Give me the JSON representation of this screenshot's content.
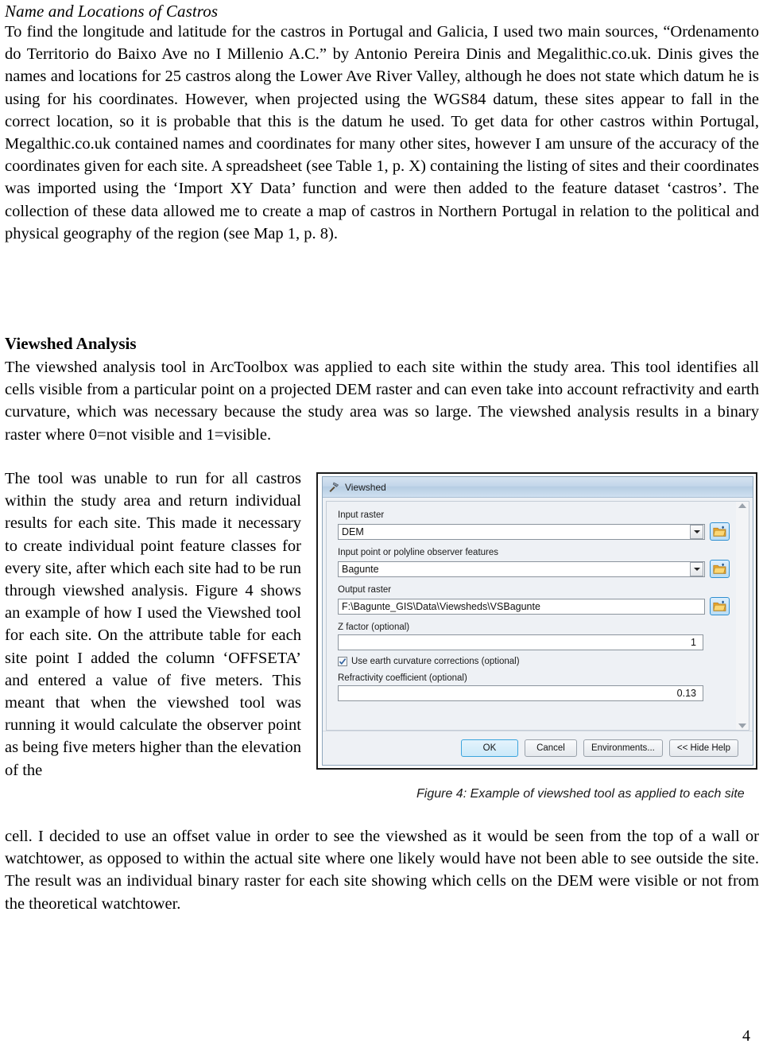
{
  "document": {
    "page_number": "4",
    "sections": [
      {
        "heading": "Name and Locations of Castros",
        "heading_style": "italic",
        "paragraph": "To find the longitude and latitude for the castros in Portugal and Galicia, I used two main sources, “Ordenamento do Territorio do Baixo Ave no I Millenio A.C.” by Antonio Pereira Dinis and Megalithic.co.uk. Dinis gives the names and locations for 25 castros along the Lower Ave River Valley, although he does not state which datum he is using for his coordinates. However, when projected using the WGS84 datum, these sites appear to fall in the correct location, so it is probable that this is the datum he used. To get data for other castros within Portugal, Megalthic.co.uk contained names and coordinates for many other sites, however I am unsure of the accuracy of the coordinates given for each site. A spreadsheet (see Table 1, p. X) containing the listing of sites and their coordinates was imported using the ‘Import XY Data’ function and were then added to the feature dataset ‘castros’. The collection of these data allowed me to create a map of castros in Northern Portugal in relation to the political and physical geography of the region (see Map 1, p. 8)."
      },
      {
        "heading": "Viewshed Analysis",
        "heading_style": "bold",
        "paragraph": "The viewshed analysis tool in ArcToolbox was applied to each site within the study area. This tool identifies all cells visible from a particular point on a projected DEM raster and can even take into account refractivity and earth curvature, which was necessary because the study area was so large. The viewshed analysis results in a binary raster where 0=not visible and 1=visible."
      }
    ],
    "wrapped_paragraph": {
      "narrow_column": "The tool was unable to run for all castros within the study area and return individual results for each site. This made it necessary to create individual point feature classes for every site, after which each site had to be run through viewshed analysis. Figure 4 shows an example of how I used the Viewshed tool for each site. On the attribute table for each site point I added the column ‘OFFSETA’ and entered a value of five meters. This meant that when the viewshed tool was running it would calculate the observer point as being five meters higher than the elevation of the",
      "full_width": "cell. I decided to use an offset value in order to see the viewshed as it would be seen from the top of a wall or watchtower, as opposed to within the actual site where one likely would have not been able to see outside the site. The result was an individual binary raster for each site showing which cells on the DEM were visible or not from the theoretical watchtower."
    },
    "figure": {
      "caption": "Figure 4: Example of viewshed tool as applied to each site"
    }
  },
  "viewshed_dialog": {
    "title": "Viewshed",
    "title_icon": "hammer-icon",
    "fields": [
      {
        "label": "Input raster",
        "value": "DEM",
        "control": "combobox",
        "browse_icon": "folder-open-icon"
      },
      {
        "label": "Input point or polyline observer features",
        "value": "Bagunte",
        "control": "combobox",
        "browse_icon": "folder-open-icon"
      },
      {
        "label": "Output raster",
        "value": "F:\\Bagunte_GIS\\Data\\Viewsheds\\VSBagunte",
        "control": "textbox",
        "browse_icon": "folder-open-icon"
      },
      {
        "label": "Z factor (optional)",
        "value": "1",
        "control": "numberbox"
      }
    ],
    "checkbox": {
      "label": "Use earth curvature corrections (optional)",
      "checked": true
    },
    "refractivity": {
      "label": "Refractivity coefficient (optional)",
      "value": "0.13"
    },
    "buttons": {
      "ok": "OK",
      "cancel": "Cancel",
      "environments": "Environments...",
      "hide_help": "<< Hide Help"
    },
    "scrollbar": {
      "up_icon": "scroll-up-arrow-icon",
      "down_icon": "scroll-down-arrow-icon"
    },
    "colors": {
      "titlebar": "#c3d6ea",
      "dialog_bg": "#eef1f5",
      "accent_primary": "#3ba4dd",
      "folder_yellow": "#f2c14b",
      "border": "#1b1b1b"
    }
  }
}
